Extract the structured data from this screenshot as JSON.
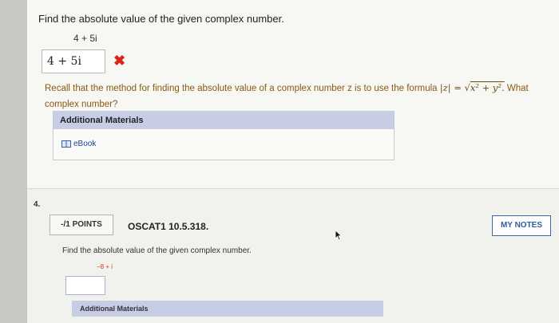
{
  "question3": {
    "prompt": "Find the absolute value of the given complex number.",
    "number": "4 + 5i",
    "answer": "4 + 5i",
    "wrong_mark": "✖",
    "feedback_before": "Recall that the method for finding the absolute value of a complex number z is to use the formula ",
    "feedback_formula_lhs": "|z| = ",
    "feedback_formula_radicand": "x² + y².",
    "feedback_after": " What complex number?",
    "materials_title": "Additional Materials",
    "ebook_label": "eBook"
  },
  "question4": {
    "index": "4.",
    "points_label": "-/1 POINTS",
    "problem_id": "OSCAT1 10.5.318.",
    "notes_label": "MY NOTES",
    "prompt": "Find the absolute value of the given complex number.",
    "number": "−8 + i",
    "materials_title": "Additional Materials"
  },
  "colors": {
    "error": "#d8251b",
    "feedback": "#8a5a10",
    "materials_header": "#c8cde6",
    "link": "#1f3f9e"
  }
}
